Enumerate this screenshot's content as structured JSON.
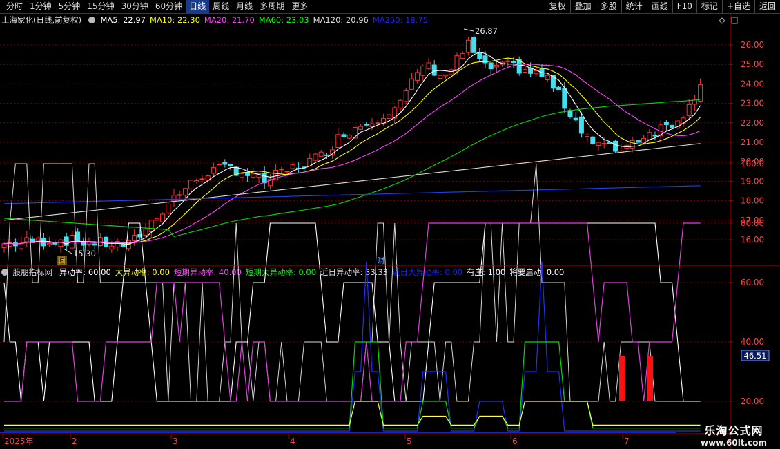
{
  "toolbar": {
    "periods": [
      "分时",
      "1分钟",
      "5分钟",
      "15分钟",
      "30分钟",
      "60分钟",
      "日线",
      "周线",
      "月线",
      "多周期",
      "更多"
    ],
    "active_period": "日线",
    "right_buttons": [
      "复权",
      "叠加",
      "多股",
      "统计",
      "画线",
      "F10",
      "标记",
      "+自选",
      "返回"
    ]
  },
  "main_legend": {
    "title": "上海家化(日线,前复权)",
    "items": [
      {
        "label": "MA5: 22.97",
        "color": "#ffffff"
      },
      {
        "label": "MA10: 22.30",
        "color": "#ffff00"
      },
      {
        "label": "MA20: 21.70",
        "color": "#ff40ff"
      },
      {
        "label": "MA60: 23.03",
        "color": "#00ff00"
      },
      {
        "label": "MA120: 20.96",
        "color": "#dcdcdc"
      },
      {
        "label": "MA250: 18.75",
        "color": "#2020ff"
      }
    ]
  },
  "price_axis": [
    "26.00",
    "25.00",
    "24.00",
    "23.00",
    "22.00",
    "21.00",
    "20.00",
    "19.00",
    "18.00",
    "17.00",
    "16.00"
  ],
  "price_annotations": {
    "high": "26.87",
    "low": "15.30",
    "event_marker": "财",
    "low_marker": "回"
  },
  "indicator_legend": {
    "title": "股朋指标网",
    "items": [
      {
        "label": "异动率: 60.00",
        "color": "#ffffff"
      },
      {
        "label": "大异动率: 0.00",
        "color": "#ffff00"
      },
      {
        "label": "短期异动率: 40.00",
        "color": "#ff40ff"
      },
      {
        "label": "短期大异动率: 0.00",
        "color": "#00ff00"
      },
      {
        "label": "近日异动率: 33.33",
        "color": "#dcdcdc"
      },
      {
        "label": "近日大异动率: 0.00",
        "color": "#2020ff"
      },
      {
        "label": "有庄: 1.00",
        "color": "#ffffff"
      },
      {
        "label": "将要启动: 0.00",
        "color": "#ffffff"
      }
    ]
  },
  "indicator_axis": [
    "100.0",
    "80.00",
    "60.00",
    "40.00",
    "20.00"
  ],
  "indicator_cursor_value": "46.51",
  "date_axis": [
    "2025年",
    "2",
    "3",
    "4",
    "5",
    "6",
    "7"
  ],
  "watermark": {
    "line1": "乐淘公式网",
    "line2": "www.60lt.com"
  },
  "colors": {
    "up": "#ff3030",
    "down": "#40e0f0",
    "grid": "#8b0000",
    "axis": "#b00000"
  }
}
